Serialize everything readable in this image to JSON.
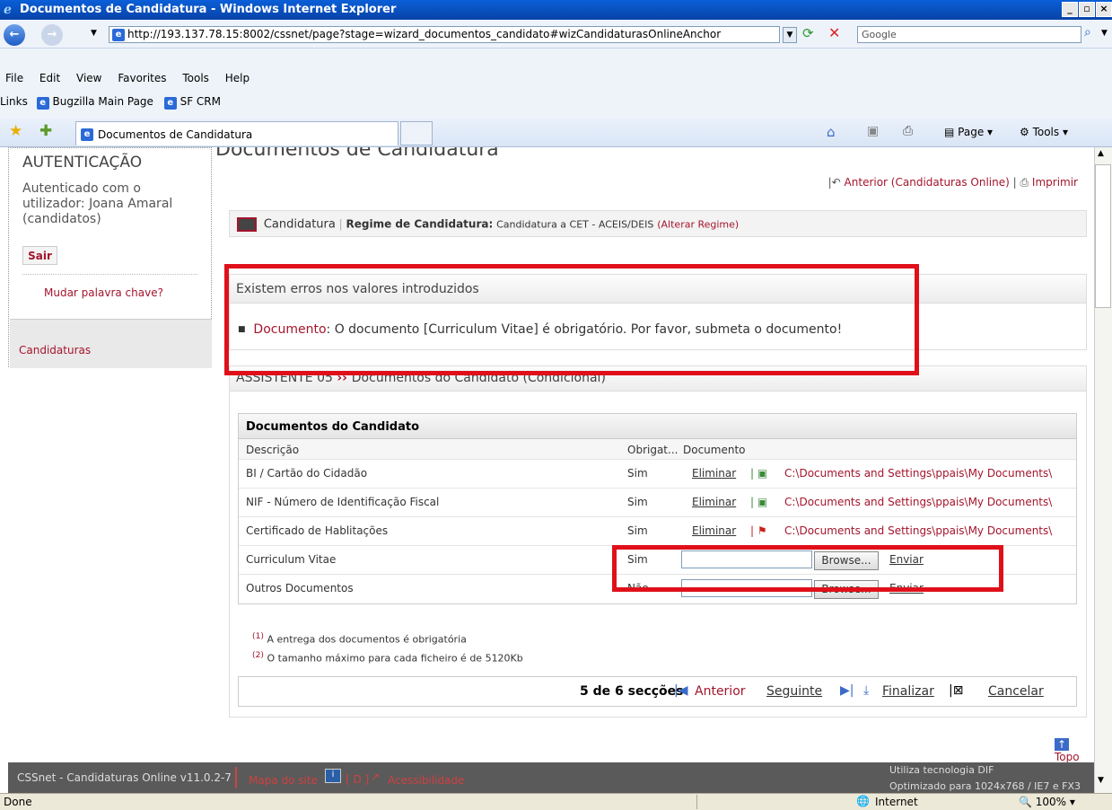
{
  "window": {
    "title": "Documentos de Candidatura - Windows Internet Explorer"
  },
  "address": {
    "url": "http://193.137.78.15:8002/cssnet/page?stage=wizard_documentos_candidato#wizCandidaturasOnlineAnchor",
    "search_placeholder": "Google"
  },
  "menu": [
    "File",
    "Edit",
    "View",
    "Favorites",
    "Tools",
    "Help"
  ],
  "links": {
    "label": "Links",
    "items": [
      "Bugzilla Main Page",
      "SF CRM"
    ]
  },
  "tab": {
    "title": "Documentos de Candidatura"
  },
  "ie_tools": {
    "page": "Page",
    "tools": "Tools"
  },
  "sidebar": {
    "title": "AUTENTICAÇÃO",
    "auth_text": "Autenticado com o utilizador: Joana Amaral (candidatos)",
    "logout": "Sair",
    "change_password": "Mudar palavra chave?",
    "applications": "Candidaturas"
  },
  "main": {
    "title": "Documentos de Candidatura",
    "back_link": "Anterior (Candidaturas Online)",
    "print": "Imprimir",
    "cand_label": "Candidatura",
    "regime_label": "Regime de Candidatura:",
    "regime_value": "Candidatura a CET - ACEIS/DEIS",
    "regime_change": "(Alterar Regime)"
  },
  "errors": {
    "heading": "Existem erros nos valores introduzidos",
    "field": "Documento",
    "message": ": O documento [Curriculum Vitae] é obrigatório. Por favor, submeta o documento!"
  },
  "wizard": {
    "step": "ASSISTENTE 05",
    "title": "Documentos do Candidato (Condicional)",
    "table_title": "Documentos do Candidato",
    "columns": [
      "Descrição",
      "Obrigat...",
      "Documento"
    ],
    "rows": [
      {
        "desc": "BI / Cartão do Cidadão",
        "req": "Sim",
        "action": "Eliminar",
        "path": "C:\\Documents and Settings\\ppais\\My Documents\\"
      },
      {
        "desc": "NIF - Número de Identificação Fiscal",
        "req": "Sim",
        "action": "Eliminar",
        "path": "C:\\Documents and Settings\\ppais\\My Documents\\"
      },
      {
        "desc": "Certificado de Hablitações",
        "req": "Sim",
        "action": "Eliminar",
        "path": "C:\\Documents and Settings\\ppais\\My Documents\\"
      },
      {
        "desc": "Curriculum Vitae",
        "req": "Sim",
        "browse": "Browse...",
        "send": "Enviar"
      },
      {
        "desc": "Outros Documentos",
        "req": "Não",
        "browse": "Browse...",
        "send": "Enviar"
      }
    ],
    "note1": "A entrega dos documentos é obrigatória",
    "note2": "O tamanho máximo para cada ficheiro é de 5120Kb",
    "nav": {
      "sections": "5 de 6 secções",
      "prev": "Anterior",
      "next": "Seguinte",
      "finish": "Finalizar",
      "cancel": "Cancelar"
    },
    "top": "Topo"
  },
  "footer": {
    "version": "CSSnet - Candidaturas Online v11.0.2-7",
    "sitemap": "Mapa do site",
    "accessibility": "Acessibilidade",
    "tech1": "Utiliza tecnologia DIF",
    "tech2": "Optimizado para 1024x768 / IE7 e FX3"
  },
  "status": {
    "text": "Done",
    "zone": "Internet",
    "zoom": "100%"
  }
}
